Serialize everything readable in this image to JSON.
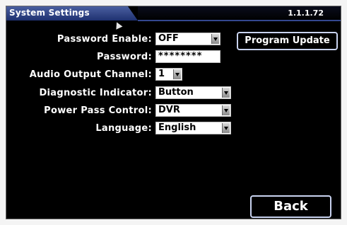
{
  "window": {
    "title": "System Settings",
    "version": "1.1.1.72"
  },
  "settings": [
    {
      "label": "Password Enable:",
      "value": "OFF",
      "dropdown": true
    },
    {
      "label": "Password:",
      "value": "********",
      "dropdown": false
    },
    {
      "label": "Audio Output Channel:",
      "value": "1",
      "dropdown": true
    },
    {
      "label": "Diagnostic Indicator:",
      "value": "Button",
      "dropdown": true
    },
    {
      "label": "Power Pass Control:",
      "value": "DVR",
      "dropdown": true
    },
    {
      "label": "Language:",
      "value": "English",
      "dropdown": true
    }
  ],
  "buttons": {
    "program_update": "Program Update",
    "back": "Back"
  },
  "icons": {
    "cursor": "pointer-arrow-icon",
    "dropdown": "chevron-down-icon"
  }
}
